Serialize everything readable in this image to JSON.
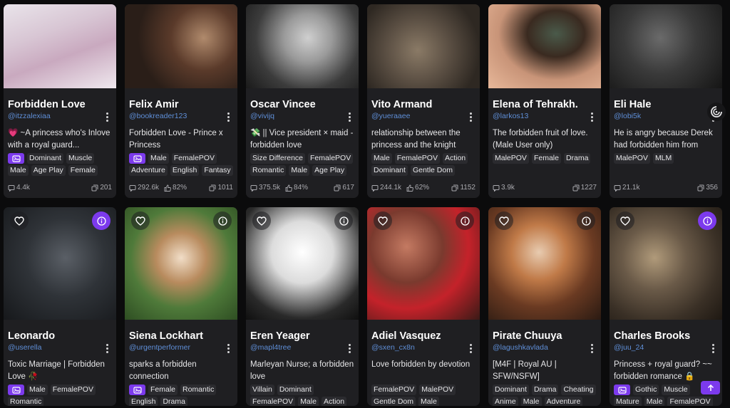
{
  "row1": [
    {
      "name": "Forbidden Love",
      "handle": "@itzzalexiaa",
      "desc": "💗 ~A princess who's Inlove with a royal guard...",
      "nsfw": true,
      "tags": [
        "Dominant",
        "Muscle",
        "Male",
        "Age Play",
        "Female"
      ],
      "chats": "4.4k",
      "likes": "",
      "cards": "201"
    },
    {
      "name": "Felix Amir",
      "handle": "@bookreader123",
      "desc": "Forbidden Love - Prince x Princess",
      "nsfw": true,
      "tags": [
        "Male",
        "FemalePOV",
        "Adventure",
        "English",
        "Fantasy"
      ],
      "chats": "292.6k",
      "likes": "82%",
      "cards": "1011"
    },
    {
      "name": "Oscar Vincee",
      "handle": "@vivijq",
      "desc": "💸 || Vice president × maid - forbidden love",
      "nsfw": false,
      "tags": [
        "Size Difference",
        "FemalePOV",
        "Romantic",
        "Male",
        "Age Play"
      ],
      "chats": "375.5k",
      "likes": "84%",
      "cards": "617"
    },
    {
      "name": "Vito Armand",
      "handle": "@yueraaee",
      "desc": "relationship between the princess and the knight",
      "nsfw": false,
      "tags": [
        "Male",
        "FemalePOV",
        "Action",
        "Dominant",
        "Gentle Dom"
      ],
      "chats": "244.1k",
      "likes": "62%",
      "cards": "1152"
    },
    {
      "name": "Elena of Tehrakh.",
      "handle": "@larkos13",
      "desc": "The forbidden fruit of love. (Male User only)",
      "nsfw": false,
      "tags": [
        "MalePOV",
        "Female",
        "Drama"
      ],
      "chats": "3.9k",
      "likes": "",
      "cards": "1227"
    },
    {
      "name": "Eli Hale",
      "handle": "@lobi5k",
      "desc": "He is angry because Derek had forbidden him from being near you.",
      "nsfw": false,
      "tags": [
        "MalePOV",
        "MLM"
      ],
      "chats": "21.1k",
      "likes": "",
      "cards": "356"
    }
  ],
  "row2": [
    {
      "name": "Leonardo",
      "handle": "@userella",
      "desc": "Toxic Marriage | Forbidden Love 🥀",
      "nsfw": true,
      "info_accent": true,
      "tags": [
        "Male",
        "FemalePOV",
        "Romantic"
      ]
    },
    {
      "name": "Siena Lockhart",
      "handle": "@urgentperformer",
      "desc": "sparks a forbidden connection",
      "nsfw": true,
      "info_accent": false,
      "tags": [
        "Female",
        "Romantic",
        "English",
        "Drama"
      ]
    },
    {
      "name": "Eren Yeager",
      "handle": "@mapl4tree",
      "desc": "Marleyan Nurse; a forbidden love",
      "nsfw": false,
      "info_accent": false,
      "tags": [
        "Villain",
        "Dominant",
        "FemalePOV",
        "Male",
        "Action"
      ]
    },
    {
      "name": "Adiel Vasquez",
      "handle": "@sxen_cx8n",
      "desc": "Love forbidden by devotion",
      "nsfw": false,
      "info_accent": false,
      "tags": [
        "FemalePOV",
        "MalePOV",
        "Gentle Dom",
        "Male"
      ]
    },
    {
      "name": "Pirate Chuuya",
      "handle": "@lagushkavlada",
      "desc": "[M4F | Royal AU | SFW/NSFW]",
      "nsfw": false,
      "info_accent": false,
      "tags": [
        "Dominant",
        "Drama",
        "Cheating",
        "Anime",
        "Male",
        "Adventure"
      ]
    },
    {
      "name": "Charles Brooks",
      "handle": "@juu_24",
      "desc": "Princess + royal guard? ~~ forbidden romance 🔒",
      "nsfw": true,
      "info_accent": true,
      "tags": [
        "Gothic",
        "Muscle",
        "Mature",
        "Male",
        "FemalePOV"
      ]
    }
  ],
  "icons": {
    "heart": "heart-icon",
    "info": "info-icon",
    "kebab": "more-vert-icon",
    "chat": "chat-icon",
    "like": "thumbs-up-icon",
    "cards": "cards-icon",
    "widget": "spiral-icon",
    "scroll": "arrow-up-icon",
    "nsfw": "image-badge-icon"
  },
  "colors": {
    "accent": "#7c3aed",
    "handle": "#5f8fd8",
    "card": "#1f1f22",
    "bg": "#0b0b0c"
  }
}
